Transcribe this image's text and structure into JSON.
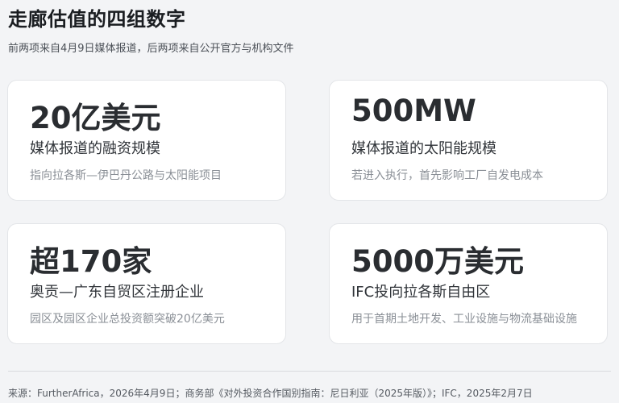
{
  "header": {
    "title": "走廊估值的四组数字",
    "subtitle": "前两项来自4月9日媒体报道，后两项来自公开官方与机构文件"
  },
  "cards": [
    {
      "value": "20亿美元",
      "label": "媒体报道的融资规模",
      "description": "指向拉各斯—伊巴丹公路与太阳能项目"
    },
    {
      "value": "500MW",
      "label": "媒体报道的太阳能规模",
      "description": "若进入执行，首先影响工厂自发电成本"
    },
    {
      "value": "超170家",
      "label": "奥贡—广东自贸区注册企业",
      "description": "园区及园区企业总投资额突破20亿美元"
    },
    {
      "value": "5000万美元",
      "label": "IFC投向拉各斯自由区",
      "description": "用于首期土地开发、工业设施与物流基础设施"
    }
  ],
  "footer": {
    "source": "来源：FurtherAfrica，2026年4月9日；商务部《对外投资合作国别指南：尼日利亚（2025年版）》；IFC，2025年2月7日"
  }
}
